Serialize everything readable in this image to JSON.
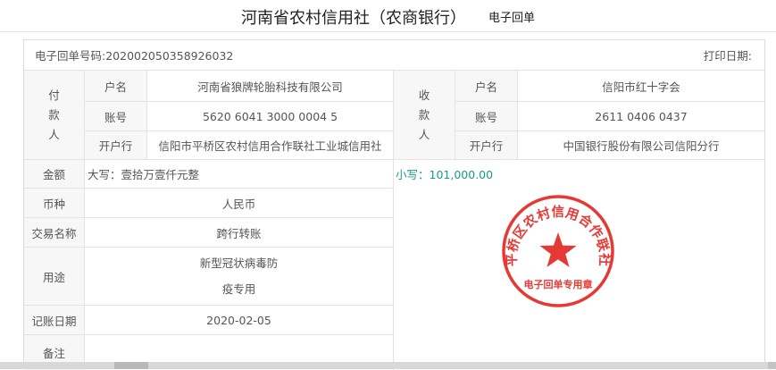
{
  "header": {
    "bank_name": "河南省农村信用社（农商银行）",
    "doc_type": "电子回单"
  },
  "receipt": {
    "number_text": "电子回单号码:202002050358926032",
    "print_date_label": "打印日期:",
    "payer": {
      "section_label": [
        "付",
        "款",
        "人"
      ],
      "name_label": "户名",
      "name": "河南省狼牌轮胎科技有限公司",
      "account_label": "账号",
      "account": "5620 6041 3000 0004 5",
      "bank_label": "开户行",
      "bank": "信阳市平桥区农村信用合作联社工业城信用社"
    },
    "payee": {
      "section_label": [
        "收",
        "款",
        "人"
      ],
      "name_label": "户名",
      "name": "信阳市红十字会",
      "account_label": "账号",
      "account": "2611 0406 0437",
      "bank_label": "开户行",
      "bank": "中国银行股份有限公司信阳分行"
    },
    "amount_label": "金额",
    "amount_uppercase": "大写：壹拾万壹仟元整",
    "amount_numeric": "小写：101,000.00",
    "currency_label": "币种",
    "currency": "人民币",
    "transaction_label": "交易名称",
    "transaction": "跨行转账",
    "purpose_label": "用途",
    "purpose_lines": [
      "新型冠状病毒防",
      "疫专用"
    ],
    "booking_date_label": "记账日期",
    "booking_date": "2020-02-05",
    "remarks_label": "备注",
    "remarks": ""
  },
  "stamp": {
    "text": "平桥区农村信用合作联社",
    "bottom_text": "电子回单专用章",
    "color": "#e53935"
  },
  "colors": {
    "border": "#e3e3e3",
    "label_bg": "#f7f7f7",
    "amount_numeric": "#1a9a8a"
  }
}
